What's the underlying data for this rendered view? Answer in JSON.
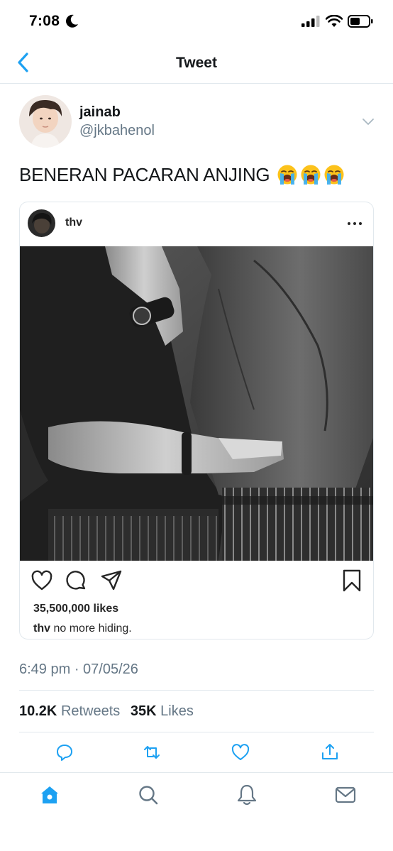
{
  "status_bar": {
    "time": "7:08"
  },
  "nav": {
    "title": "Tweet"
  },
  "tweet": {
    "author_name": "jainab",
    "author_handle": "@jkbahenol",
    "text": "BENERAN PACARAN ANJING",
    "emoji": "loudly-crying-face x3",
    "timestamp": "6:49 pm · 07/05/26",
    "retweets_count": "10.2K",
    "retweets_label": "Retweets",
    "likes_count": "35K",
    "likes_label": "Likes"
  },
  "embedded_post": {
    "username": "thv",
    "likes": "35,500,000 likes",
    "caption_user": "thv",
    "caption_text": "no more hiding."
  },
  "icons": {
    "accent": "#1da1f2",
    "tab_bar": [
      "home-icon",
      "search-icon",
      "notifications-icon",
      "messages-icon"
    ],
    "tweet_actions": [
      "reply-icon",
      "retweet-icon",
      "like-icon",
      "share-icon"
    ]
  }
}
